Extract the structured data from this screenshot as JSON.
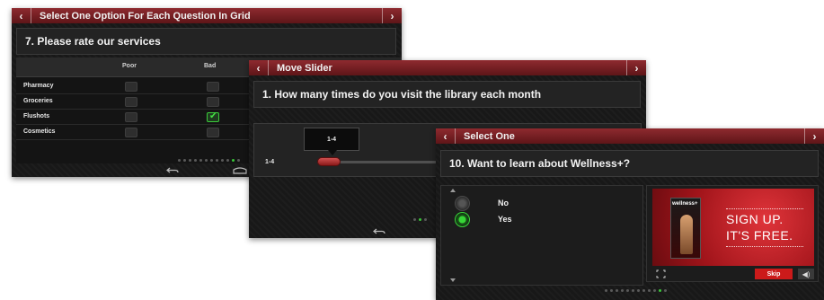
{
  "screen1": {
    "title": "Select One Option For Each Question In Grid",
    "nav_back": "‹",
    "nav_next": "›",
    "question": "7. Please rate our services",
    "columns": [
      "Poor",
      "Bad"
    ],
    "rows": [
      {
        "label": "Pharmacy",
        "checked": [
          false,
          false
        ]
      },
      {
        "label": "Groceries",
        "checked": [
          false,
          false
        ]
      },
      {
        "label": "Flushots",
        "checked": [
          false,
          true
        ]
      },
      {
        "label": "Cosmetics",
        "checked": [
          false,
          false
        ]
      }
    ]
  },
  "screen2": {
    "title": "Move Slider",
    "nav_back": "‹",
    "nav_next": "›",
    "question": "1. How many  times do you visit the library each month",
    "bubble_value": "1-4",
    "slider_label": "1-4"
  },
  "screen3": {
    "title": "Select One",
    "nav_back": "‹",
    "nav_next": "›",
    "question": "10. Want to learn about Wellness+?",
    "options": [
      {
        "label": "No",
        "selected": false
      },
      {
        "label": "Yes",
        "selected": true
      }
    ],
    "promo": {
      "line1": "SIGN UP.",
      "line2": "IT'S FREE.",
      "book_title": "wellness+"
    },
    "skip_label": "Skip",
    "volume_icon": "volume-icon"
  },
  "colors": {
    "titlebar": "#8e2a2f",
    "accent_green": "#39c639",
    "skip_red": "#cc1a1a"
  }
}
